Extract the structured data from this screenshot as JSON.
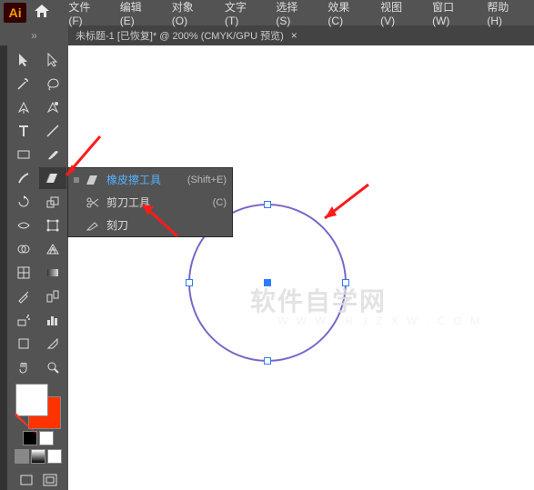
{
  "app": {
    "logo_text": "Ai"
  },
  "menu": {
    "file": "文件(F)",
    "edit": "编辑(E)",
    "object": "对象(O)",
    "text": "文字(T)",
    "select": "选择(S)",
    "effect": "效果(C)",
    "view": "视图(V)",
    "window": "窗口(W)",
    "help": "帮助(H)"
  },
  "titlebar": {
    "chevron": "»",
    "doc": "未标题-1 [已恢复]* @ 200% (CMYK/GPU 预览)",
    "close": "×"
  },
  "flyout": {
    "eraser": {
      "label": "橡皮擦工具",
      "shortcut": "(Shift+E)"
    },
    "scissors": {
      "label": "剪刀工具",
      "shortcut": "(C)"
    },
    "knife": {
      "label": "刻刀"
    }
  },
  "watermark": {
    "main": "软件自学网",
    "sub": "W W W . R J Z X W . C O M"
  },
  "chart_data": {
    "type": "diagram",
    "shape": "circle",
    "center": [
      298,
      310
    ],
    "radius": 88,
    "stroke": "#b25aa0",
    "anchors": [
      "top",
      "right",
      "bottom",
      "left",
      "center"
    ]
  }
}
